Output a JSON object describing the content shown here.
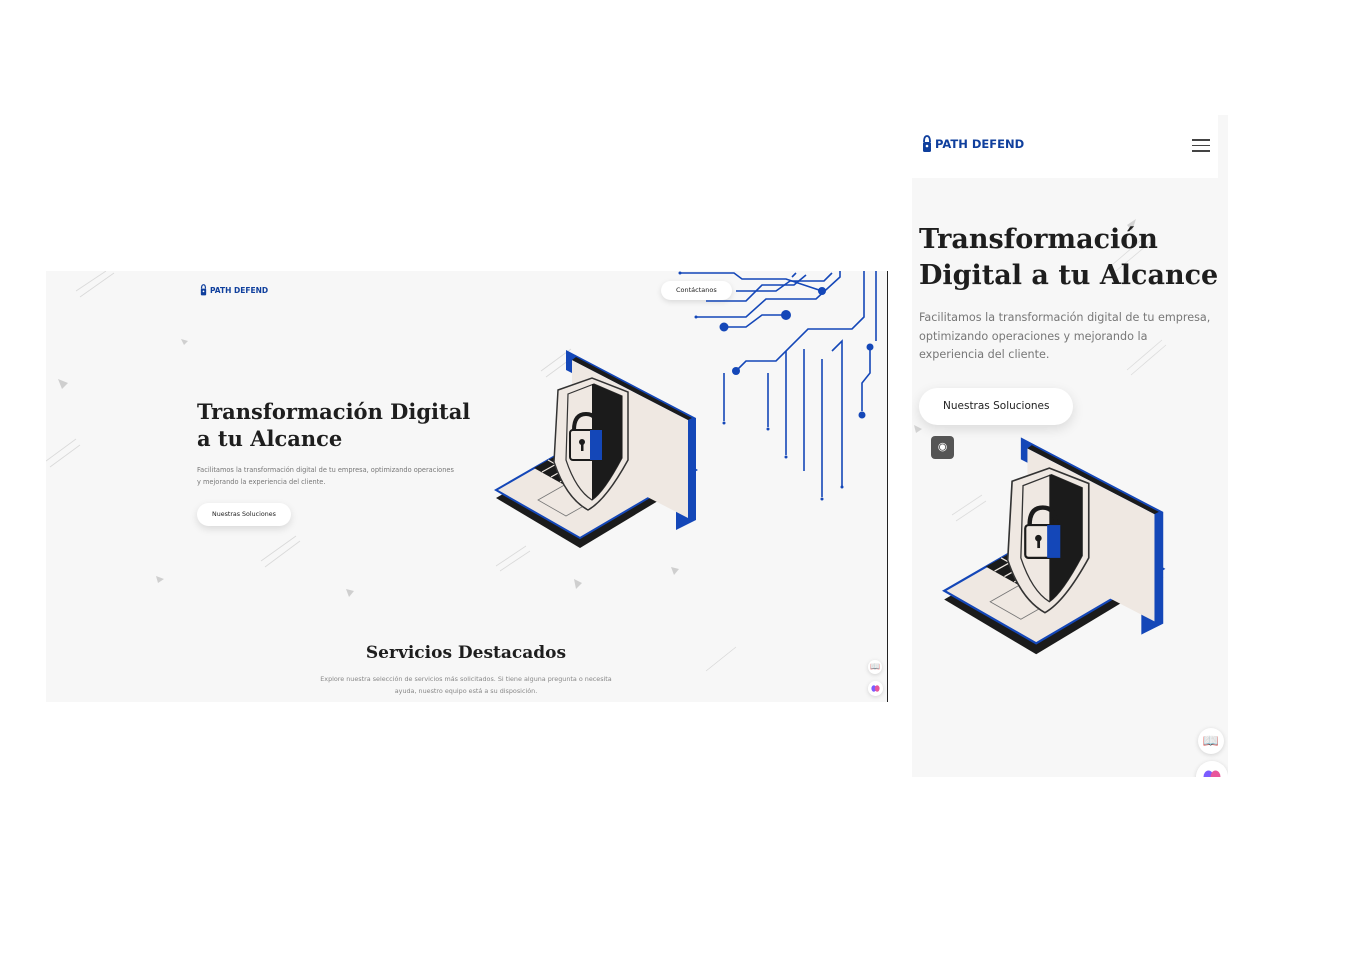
{
  "colors": {
    "brand": "#0f3f9d",
    "accent_blue": "#1447b8",
    "background": "#f7f7f7",
    "text_dark": "#1e1e1e",
    "text_muted": "#777777"
  },
  "desktop": {
    "logo_text": "PATH DEFEND",
    "contact_button": "Contáctanos",
    "hero_title": "Transformación Digital a tu Alcance",
    "hero_subtitle": "Facilitamos la transformación digital de tu empresa, optimizando operaciones y mejorando la experiencia del cliente.",
    "cta_button": "Nuestras Soluciones",
    "section_title": "Servicios Destacados",
    "section_subtitle": "Explore nuestra selección de servicios más solicitados. Si tiene alguna pregunta o necesita ayuda, nuestro equipo está a su disposición.",
    "icons": [
      "lock-shield-laptop-illustration",
      "circuit-lines",
      "book-icon",
      "brain-icon"
    ]
  },
  "mobile": {
    "logo_text": "PATH DEFEND",
    "hero_title": "Transformación Digital a tu Alcance",
    "hero_subtitle": "Facilitamos la transformación digital de tu empresa, optimizando operaciones y mejorando la experiencia del cliente.",
    "cta_button": "Nuestras Soluciones",
    "icons": [
      "hamburger-menu-icon",
      "brain-badge-icon",
      "book-icon",
      "brain-icon"
    ]
  }
}
